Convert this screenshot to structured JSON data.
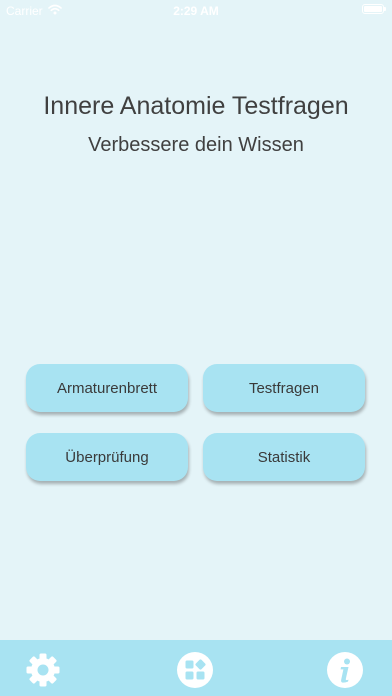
{
  "status_bar": {
    "carrier": "Carrier",
    "time": "2:29 AM"
  },
  "header": {
    "title": "Innere Anatomie Testfragen",
    "subtitle": "Verbessere dein Wissen"
  },
  "menu": {
    "dashboard_label": "Armaturenbrett",
    "questions_label": "Testfragen",
    "review_label": "Überprüfung",
    "stats_label": "Statistik"
  },
  "tab_bar": {
    "icons": [
      "gear-icon",
      "apps-grid-icon",
      "info-icon"
    ]
  },
  "colors": {
    "background": "#e4f4f8",
    "accent": "#a8e3f2",
    "text": "#404040",
    "icon": "#ffffff"
  }
}
